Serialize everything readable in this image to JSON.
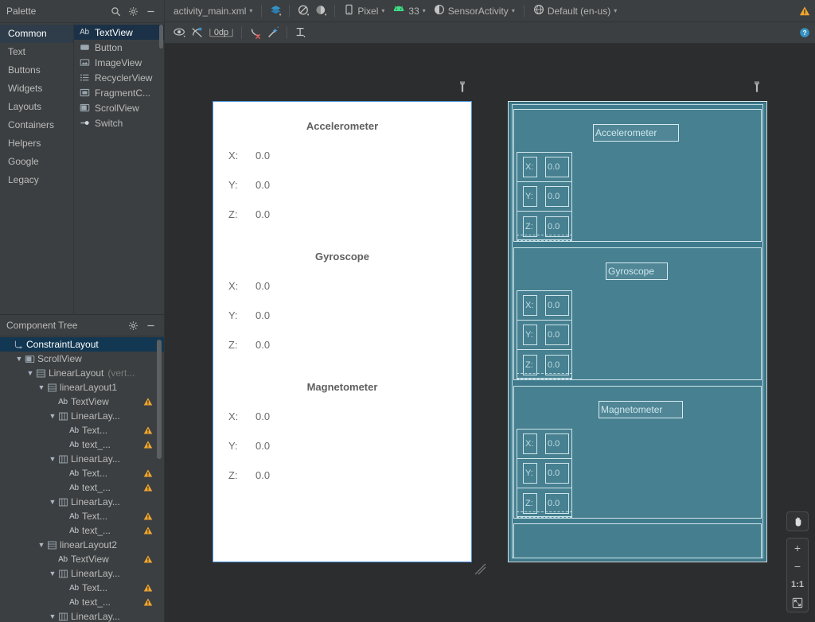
{
  "palette": {
    "title": "Palette",
    "header_icons": [
      "search-icon",
      "gear-icon",
      "minimize-icon"
    ],
    "groups": [
      {
        "label": "Common",
        "selected": true
      },
      {
        "label": "Text",
        "selected": false
      },
      {
        "label": "Buttons",
        "selected": false
      },
      {
        "label": "Widgets",
        "selected": false
      },
      {
        "label": "Layouts",
        "selected": false
      },
      {
        "label": "Containers",
        "selected": false
      },
      {
        "label": "Helpers",
        "selected": false
      },
      {
        "label": "Google",
        "selected": false
      },
      {
        "label": "Legacy",
        "selected": false
      }
    ],
    "items": [
      {
        "label": "TextView",
        "icon": "textview-ab-icon",
        "selected": true
      },
      {
        "label": "Button",
        "icon": "button-icon",
        "selected": false
      },
      {
        "label": "ImageView",
        "icon": "imageview-icon",
        "selected": false
      },
      {
        "label": "RecyclerView",
        "icon": "recyclerview-icon",
        "selected": false
      },
      {
        "label": "FragmentC...",
        "icon": "fragment-container-icon",
        "selected": false
      },
      {
        "label": "ScrollView",
        "icon": "scrollview-icon",
        "selected": false
      },
      {
        "label": "Switch",
        "icon": "switch-icon",
        "selected": false
      }
    ]
  },
  "component_tree": {
    "title": "Component Tree",
    "header_icons": [
      "gear-icon",
      "minimize-icon"
    ],
    "nodes": [
      {
        "indent": 0,
        "chevron": "",
        "icon": "constraintlayout-icon",
        "label": "ConstraintLayout",
        "sub": "",
        "warn": false,
        "selected": true
      },
      {
        "indent": 1,
        "chevron": "v",
        "icon": "scrollview-icon",
        "label": "ScrollView",
        "sub": "",
        "warn": false,
        "selected": false
      },
      {
        "indent": 2,
        "chevron": "v",
        "icon": "linearlayout-v-icon",
        "label": "LinearLayout",
        "sub": "(vert...",
        "warn": false,
        "selected": false
      },
      {
        "indent": 3,
        "chevron": "v",
        "icon": "linearlayout-v-icon",
        "label": "linearLayout1",
        "sub": "",
        "warn": false,
        "selected": false
      },
      {
        "indent": 4,
        "chevron": "",
        "icon": "textview-ab-icon",
        "label": "TextView",
        "sub": "",
        "warn": true,
        "selected": false
      },
      {
        "indent": 4,
        "chevron": "v",
        "icon": "linearlayout-h-icon",
        "label": "LinearLay...",
        "sub": "",
        "warn": false,
        "selected": false
      },
      {
        "indent": 5,
        "chevron": "",
        "icon": "textview-ab-icon",
        "label": "Text...",
        "sub": "",
        "warn": true,
        "selected": false
      },
      {
        "indent": 5,
        "chevron": "",
        "icon": "textview-ab-icon",
        "label": "text_...",
        "sub": "",
        "warn": true,
        "selected": false
      },
      {
        "indent": 4,
        "chevron": "v",
        "icon": "linearlayout-h-icon",
        "label": "LinearLay...",
        "sub": "",
        "warn": false,
        "selected": false
      },
      {
        "indent": 5,
        "chevron": "",
        "icon": "textview-ab-icon",
        "label": "Text...",
        "sub": "",
        "warn": true,
        "selected": false
      },
      {
        "indent": 5,
        "chevron": "",
        "icon": "textview-ab-icon",
        "label": "text_...",
        "sub": "",
        "warn": true,
        "selected": false
      },
      {
        "indent": 4,
        "chevron": "v",
        "icon": "linearlayout-h-icon",
        "label": "LinearLay...",
        "sub": "",
        "warn": false,
        "selected": false
      },
      {
        "indent": 5,
        "chevron": "",
        "icon": "textview-ab-icon",
        "label": "Text...",
        "sub": "",
        "warn": true,
        "selected": false
      },
      {
        "indent": 5,
        "chevron": "",
        "icon": "textview-ab-icon",
        "label": "text_...",
        "sub": "",
        "warn": true,
        "selected": false
      },
      {
        "indent": 3,
        "chevron": "v",
        "icon": "linearlayout-v-icon",
        "label": "linearLayout2",
        "sub": "",
        "warn": false,
        "selected": false
      },
      {
        "indent": 4,
        "chevron": "",
        "icon": "textview-ab-icon",
        "label": "TextView",
        "sub": "",
        "warn": true,
        "selected": false
      },
      {
        "indent": 4,
        "chevron": "v",
        "icon": "linearlayout-h-icon",
        "label": "LinearLay...",
        "sub": "",
        "warn": false,
        "selected": false
      },
      {
        "indent": 5,
        "chevron": "",
        "icon": "textview-ab-icon",
        "label": "Text...",
        "sub": "",
        "warn": true,
        "selected": false
      },
      {
        "indent": 5,
        "chevron": "",
        "icon": "textview-ab-icon",
        "label": "text_...",
        "sub": "",
        "warn": true,
        "selected": false
      },
      {
        "indent": 4,
        "chevron": "v",
        "icon": "linearlayout-h-icon",
        "label": "LinearLay...",
        "sub": "",
        "warn": false,
        "selected": false
      }
    ]
  },
  "toolbar": {
    "file_name": "activity_main.xml",
    "view_mode_icon": "layers-design-icon",
    "orientation_icon": "orientation-icon",
    "theme_icon": "theme-icon",
    "device_icon": "phone-icon",
    "device_label": "Pixel",
    "api_icon": "android-icon",
    "api_label": "33",
    "activity_icon": "theme-contrast-icon",
    "activity_label": "SensorActivity",
    "locale_icon": "globe-icon",
    "locale_label": "Default (en-us)"
  },
  "toolbar2": {
    "items": [
      {
        "name": "show-constraints-icon",
        "label": ""
      },
      {
        "name": "autoconnect-off-icon",
        "label": ""
      },
      {
        "name": "default-margin",
        "label": "0dp"
      },
      {
        "name": "clear-constraints-icon",
        "label": ""
      },
      {
        "name": "infer-constraints-icon",
        "label": ""
      },
      {
        "name": "baseline-align-icon",
        "label": ""
      }
    ]
  },
  "right_rail": {
    "warning_icon": "warning-triangle-icon",
    "help_icon": "help-circle-icon"
  },
  "preview": {
    "wrench_icon": "wrench-icon",
    "sections": [
      {
        "title": "Accelerometer",
        "rows": [
          {
            "key": "X:",
            "value": "0.0"
          },
          {
            "key": "Y:",
            "value": "0.0"
          },
          {
            "key": "Z:",
            "value": "0.0"
          }
        ]
      },
      {
        "title": "Gyroscope",
        "rows": [
          {
            "key": "X:",
            "value": "0.0"
          },
          {
            "key": "Y:",
            "value": "0.0"
          },
          {
            "key": "Z:",
            "value": "0.0"
          }
        ]
      },
      {
        "title": "Magnetometer",
        "rows": [
          {
            "key": "X:",
            "value": "0.0"
          },
          {
            "key": "Y:",
            "value": "0.0"
          },
          {
            "key": "Z:",
            "value": "0.0"
          }
        ]
      }
    ]
  },
  "zoom_controls": {
    "pan_label": "✋",
    "zoom_in_label": "+",
    "zoom_out_label": "−",
    "actual_size_label": "1:1",
    "fit_label": "⛶"
  },
  "colors": {
    "panel_bg": "#3c3f41",
    "surface_bg": "#2b2d2e",
    "selection_blue": "#1b3147",
    "tree_selection": "#123752",
    "device_border": "#4a90d9",
    "blueprint_bg": "#3f7b8c",
    "blueprint_line": "#cfe6ec",
    "warning": "#f0a732",
    "accent_blue": "#3592c4",
    "android_green": "#3ddc84"
  }
}
